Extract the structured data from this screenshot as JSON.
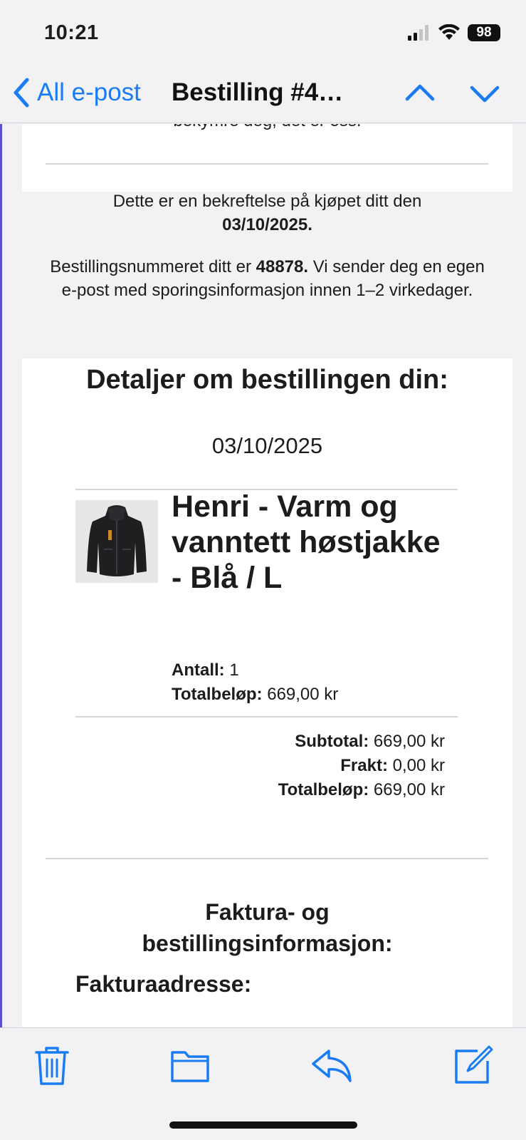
{
  "status_bar": {
    "time": "10:21",
    "battery": "98",
    "icons": [
      "cellular-signal-icon",
      "wifi-icon",
      "battery-icon"
    ]
  },
  "nav": {
    "back_label": "All e-post",
    "title": "Bestilling #4…",
    "accent_color": "#1a7cf4"
  },
  "email": {
    "cut_off_line": "bekymre deg, det er oss.",
    "confirmation_text": "Dette er en bekreftelse på kjøpet ditt den",
    "confirmation_date": "03/10/2025.",
    "order_intro": "Bestillingsnummeret ditt er",
    "order_number": "48878.",
    "order_rest": "Vi sender deg en egen e-post med sporingsinformasjon innen 1–2 virkedager.",
    "details_heading": "Detaljer om bestillingen din:",
    "details_date": "03/10/2025",
    "product": {
      "name": "Henri - Varm og vanntett høstjakke - Blå / L",
      "quantity_label": "Antall:",
      "quantity": "1",
      "total_label": "Totalbeløp:",
      "total": "669,00 kr"
    },
    "totals": {
      "subtotal_label": "Subtotal:",
      "subtotal": "669,00 kr",
      "shipping_label": "Frakt:",
      "shipping": "0,00 kr",
      "total_label": "Totalbeløp:",
      "total": "669,00 kr"
    },
    "invoice_heading_line1": "Faktura- og",
    "invoice_heading_line2": "bestillingsinformasjon:",
    "billing_address_heading": "Fakturaadresse:"
  },
  "toolbar": {
    "items": [
      "trash-icon",
      "folder-icon",
      "reply-icon",
      "compose-icon"
    ]
  }
}
